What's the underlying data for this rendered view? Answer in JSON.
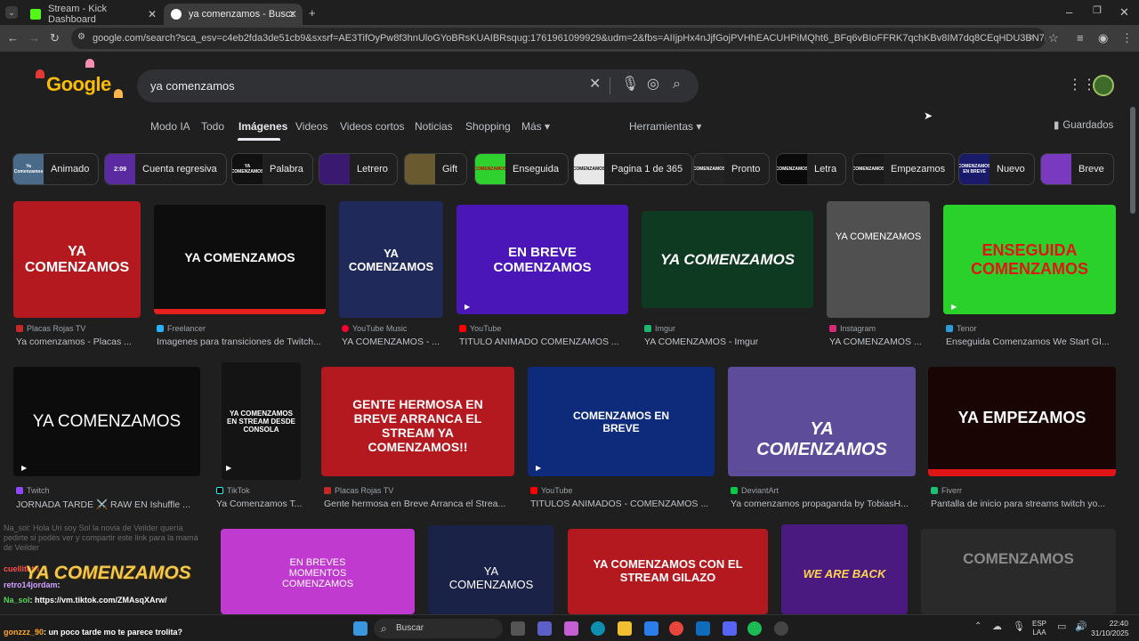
{
  "tabs": [
    {
      "title": "Stream - Kick Dashboard",
      "active": false
    },
    {
      "title": "ya comenzamos - Buscar con G",
      "active": true
    }
  ],
  "address": {
    "url": "google.com/search?sca_esv=c4eb2fda3de51cb9&sxsrf=AE3TifOyPw8f3hnUloGYoBRsKUAIBRsqug:1761961099929&udm=2&fbs=AIIjpHx4nJjfGojPVHhEACUHPiMQht6_BFq6vBIoFFRK7qchKBv8IM7dq8CEqHDU3BN7lblo0LLC9Cn6mkAPuJ2pf_SAB2jIEfeNRo..."
  },
  "search": {
    "logo": "Google",
    "query": "ya comenzamos"
  },
  "nav": {
    "tabs": [
      "Modo IA",
      "Todo",
      "Imágenes",
      "Videos",
      "Videos cortos",
      "Noticias",
      "Shopping",
      "Más ▾"
    ],
    "tools": "Herramientas ▾",
    "saved": "Guardados"
  },
  "chips": [
    {
      "label": "Animado",
      "thumb": "Ya Comenzamos",
      "color": "#4a6a8a"
    },
    {
      "label": "Cuenta regresiva",
      "thumb": "2:09",
      "color": "#5a2aa0"
    },
    {
      "label": "Palabra",
      "thumb": "YA COMENZAMOS",
      "color": "#111111"
    },
    {
      "label": "Letrero",
      "thumb": "",
      "color": "#3a1a70"
    },
    {
      "label": "Gift",
      "thumb": "",
      "color": "#6a5a30"
    },
    {
      "label": "Enseguida",
      "thumb": "COMENZAMOS",
      "color": "#2ed12e"
    },
    {
      "label": "Pagina 1 de 365",
      "thumb": "COMENZAMOS",
      "color": "#e8e8e8"
    },
    {
      "label": "Pronto",
      "thumb": "COMENZAMOS",
      "color": "#222222"
    },
    {
      "label": "Letra",
      "thumb": "COMENZAMOS",
      "color": "#0a0a0a"
    },
    {
      "label": "Empezamos",
      "thumb": "COMENZAMOS",
      "color": "#1a1a1a"
    },
    {
      "label": "Nuevo",
      "thumb": "COMENZAMOS EN BREVE",
      "color": "#1a1a6a"
    },
    {
      "label": "Breve",
      "thumb": "",
      "color": "#7a3ac0"
    }
  ],
  "results": [
    {
      "source": "Placas Rojas TV",
      "title": "Ya comenzamos - Placas ...",
      "text": "YA COMENZAMOS",
      "bg": "#b3191e",
      "video": false
    },
    {
      "source": "Freelancer",
      "title": "Imagenes para transiciones de Twitch...",
      "text": "YA COMENZAMOS",
      "bg": "#0d0d0d",
      "video": false
    },
    {
      "source": "YouTube Music",
      "title": "YA COMENZAMOS - ...",
      "text": "YA COMENZAMOS",
      "bg": "#1f2a5a",
      "video": false
    },
    {
      "source": "YouTube",
      "title": "TITULO ANIMADO COMENZAMOS ...",
      "text": "EN BREVE COMENZAMOS",
      "bg": "#4a16b8",
      "video": true
    },
    {
      "source": "Imgur",
      "title": "YA COMENZAMOS - Imgur",
      "text": "YA COMENZAMOS",
      "bg": "#0f3a22",
      "video": false
    },
    {
      "source": "Instagram",
      "title": "YA COMENZAMOS ...",
      "text": "YA COMENZAMOS",
      "bg": "#505050",
      "video": false
    },
    {
      "source": "Tenor",
      "title": "Enseguida Comenzamos We Start GI...",
      "text": "ENSEGUIDA COMENZAMOS",
      "bg": "#2bd12b",
      "video": true
    },
    {
      "source": "Twitch",
      "title": "JORNADA TARDE ⚔️ RAW EN Ishuffle ...",
      "text": "YA COMENZAMOS",
      "bg": "#0c0c0c",
      "video": true
    },
    {
      "source": "TikTok",
      "title": "Ya Comenzamos T...",
      "text": "YA COMENZAMOS EN STREAM DESDE CONSOLA",
      "bg": "#141414",
      "video": true
    },
    {
      "source": "Placas Rojas TV",
      "title": "Gente hermosa en Breve Arranca el Strea...",
      "text": "GENTE HERMOSA EN BREVE ARRANCA EL STREAM YA COMENZAMOS!!",
      "bg": "#b3191e",
      "video": false
    },
    {
      "source": "YouTube",
      "title": "TITULOS ANIMADOS - COMENZAMOS ...",
      "text": "COMENZAMOS EN BREVE",
      "bg": "#0e2a7a",
      "video": true
    },
    {
      "source": "DeviantArt",
      "title": "Ya comenzamos propaganda by TobiasH...",
      "text": "YA COMENZAMOS",
      "bg": "#5c4c9a",
      "video": false
    },
    {
      "source": "Fiverr",
      "title": "Pantalla de inicio para streams twitch yo...",
      "text": "YA EMPEZAMOS",
      "bg": "#1a0505",
      "video": false
    },
    {
      "source": "",
      "title": "",
      "text": "EN BREVES MOMENTOS COMENZAMOS",
      "bg": "#c03ad0",
      "video": false
    },
    {
      "source": "",
      "title": "",
      "text": "YA COMENZAMOS",
      "bg": "#1a2248",
      "video": false
    },
    {
      "source": "",
      "title": "",
      "text": "YA COMENZAMOS CON EL STREAM GILAZO",
      "bg": "#b3191e",
      "video": false
    },
    {
      "source": "",
      "title": "",
      "text": "WE ARE BACK",
      "bg": "#4a1a80",
      "video": false
    },
    {
      "source": "",
      "title": "",
      "text": "COMENZAMOS",
      "bg": "#2a2a2a",
      "video": false
    }
  ],
  "chat": {
    "overlay": "YA COMENZAMOS",
    "lines": [
      {
        "user": "Na_sol",
        "msg": ": Hola Uri soy Sol la novia de Veilder quería pedirte si podés ver y compartir este link para la mamá de Veilder"
      },
      {
        "user": "cuellitotn",
        "msg": ""
      },
      {
        "user": "retro14jordam",
        "msg": ":"
      },
      {
        "user": "Na_sol",
        "msg": ": https://vm.tiktok.com/ZMAsqXArw/"
      },
      {
        "user": "gonzzz_90",
        "msg": ": un poco tarde mo te parece trolita?"
      }
    ]
  },
  "taskbar": {
    "search": "Buscar",
    "lang": "ESP",
    "lang2": "LAA",
    "time": "22:40",
    "date": "31/10/2025"
  }
}
